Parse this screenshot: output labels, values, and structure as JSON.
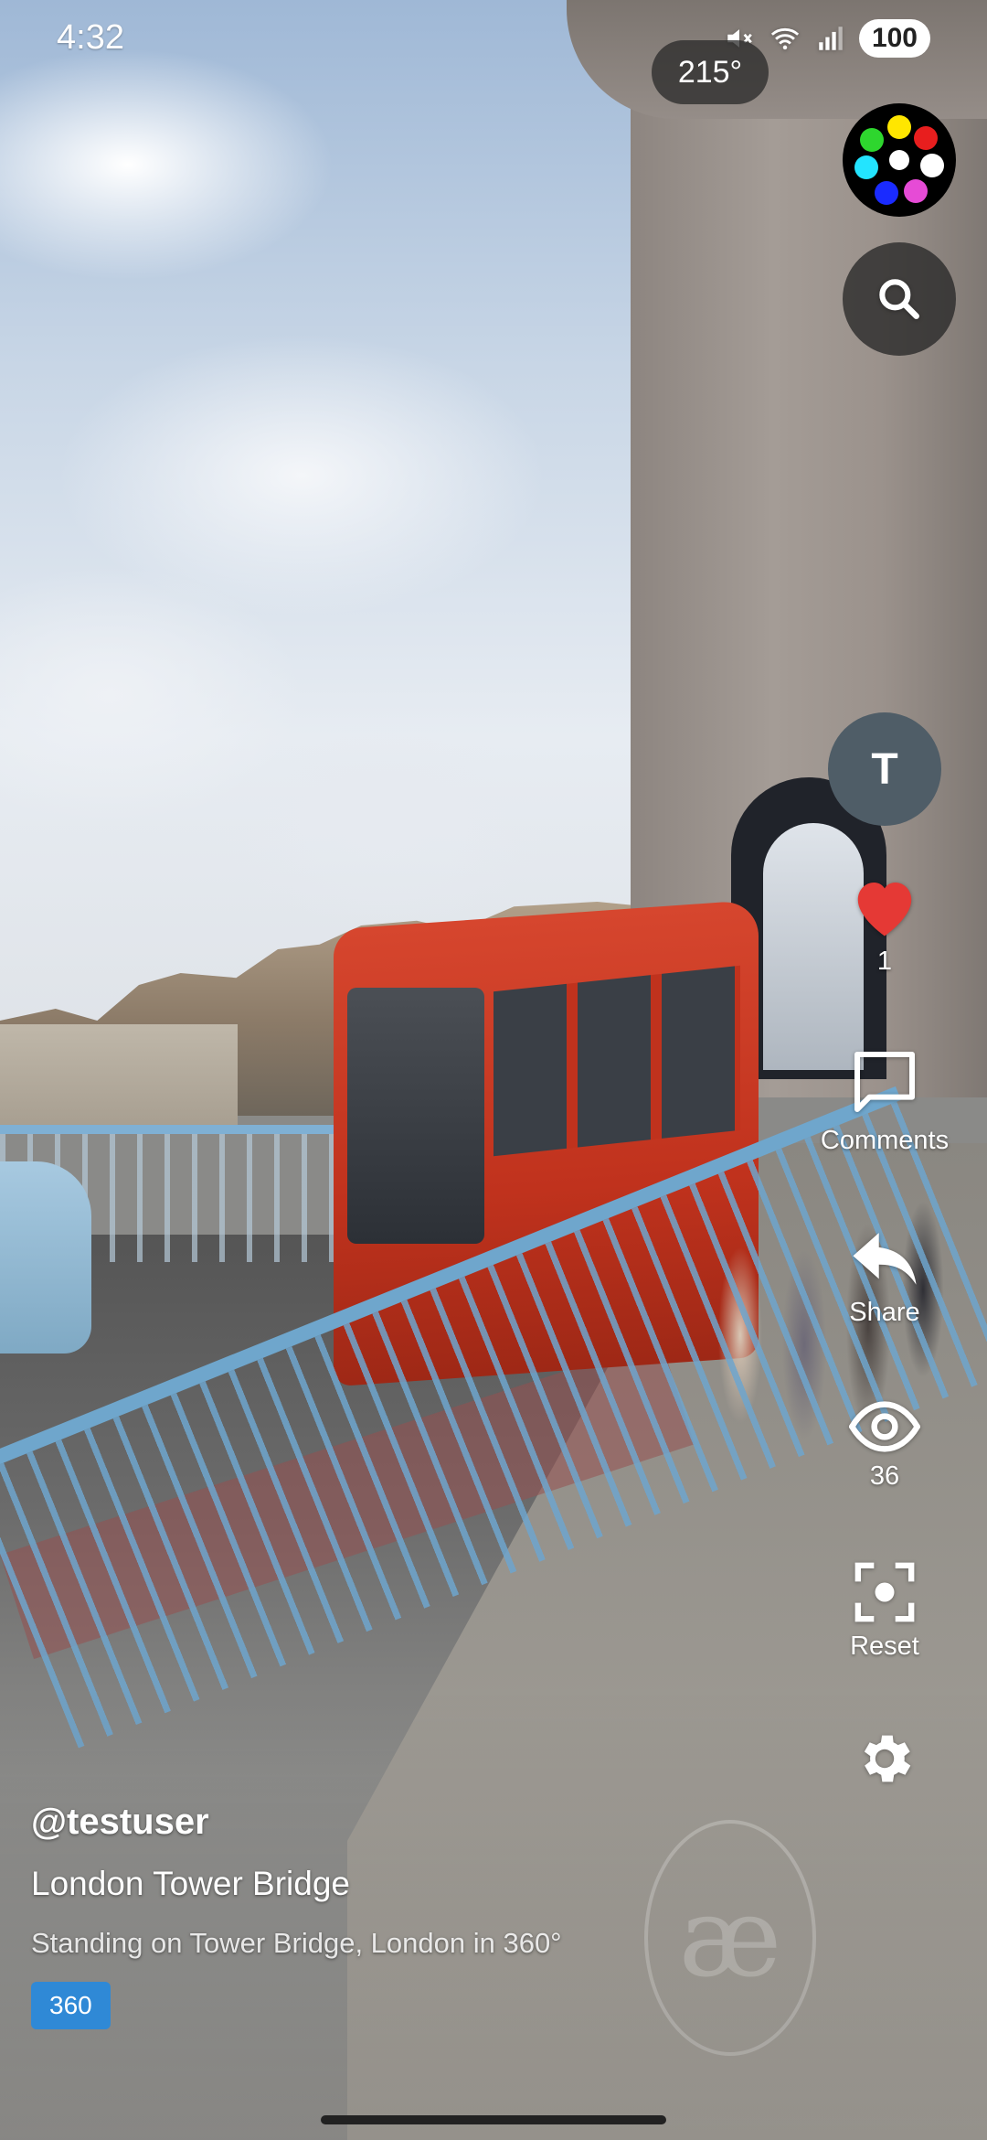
{
  "status_bar": {
    "time": "4:32",
    "battery": "100",
    "icons": [
      "mute-icon",
      "wifi-icon",
      "signal-icon"
    ]
  },
  "viewer": {
    "heading": "215°",
    "watermark": "æ"
  },
  "sidebar": {
    "avatar_initial": "T",
    "like_count": "1",
    "comments_label": "Comments",
    "share_label": "Share",
    "views_count": "36",
    "reset_label": "Reset"
  },
  "post": {
    "username": "@testuser",
    "title": "London Tower Bridge",
    "description": "Standing on Tower Bridge, London in 360°",
    "badge": "360"
  },
  "colors": {
    "like": "#e53935",
    "badge": "#2f89d6",
    "avatar": "#4f5d67"
  }
}
